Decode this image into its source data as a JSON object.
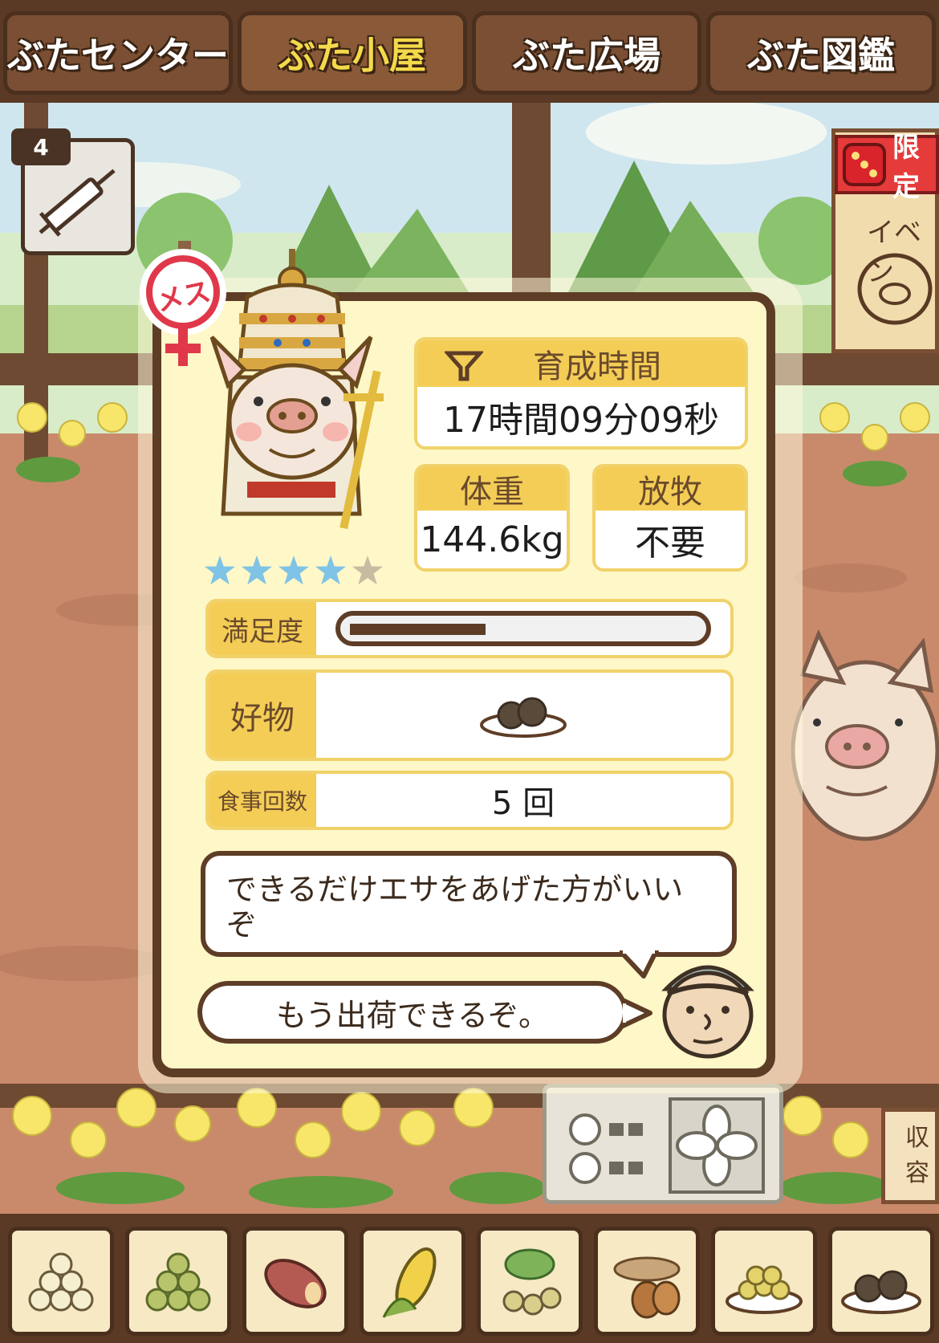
{
  "tabs": [
    {
      "label": "ぶたセンター",
      "active": false
    },
    {
      "label": "ぶた小屋",
      "active": true
    },
    {
      "label": "ぶた広場",
      "active": false
    },
    {
      "label": "ぶた図鑑",
      "active": false
    }
  ],
  "item_count": "4",
  "event_sign": {
    "limited": "限定",
    "label": "イベン"
  },
  "storage_sign": "収容",
  "pig": {
    "gender_label": "メス",
    "rating": 4,
    "max_rating": 5
  },
  "growth_time": {
    "label": "育成時間",
    "value": "17時間09分09秒"
  },
  "weight": {
    "label": "体重",
    "value": "144.6kg"
  },
  "grazing": {
    "label": "放牧",
    "value": "不要"
  },
  "satisfaction": {
    "label": "満足度",
    "level": 0.38
  },
  "favorite": {
    "label": "好物",
    "icon": "meatball-plate-icon"
  },
  "meals": {
    "label": "食事回数",
    "value": "5 回"
  },
  "advice_bubble": "できるだけエサをあげた方がいいぞ",
  "status_bubble": "もう出荷できるぞ。",
  "food_tray": [
    {
      "icon": "grain-pile-icon"
    },
    {
      "icon": "green-bean-pile-icon"
    },
    {
      "icon": "sweet-potato-icon"
    },
    {
      "icon": "corn-icon"
    },
    {
      "icon": "herb-nuts-icon"
    },
    {
      "icon": "acorn-icon"
    },
    {
      "icon": "bean-plate-icon"
    },
    {
      "icon": "meatball-plate-icon"
    }
  ],
  "colors": {
    "panel_bg": "#fef7c8",
    "label_yellow": "#f4cd56",
    "wood_dark": "#5e3d26",
    "star_blue": "#7fc3e6",
    "star_grey": "#c7bca2",
    "gender_red": "#e0384a"
  }
}
